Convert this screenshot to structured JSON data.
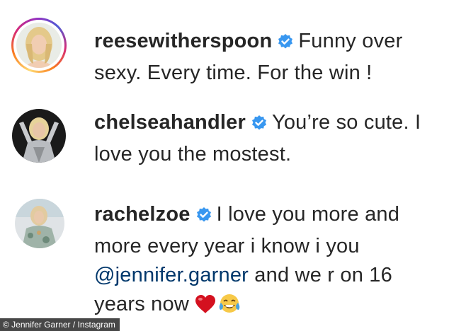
{
  "comments": [
    {
      "username": "reesewitherspoon",
      "text_line1": "Funny over",
      "text_rest": "sexy. Every time. For the win !"
    },
    {
      "username": "chelseahandler",
      "text_line1": "You’re so cute. I",
      "text_rest": "love you the mostest."
    },
    {
      "username": "rachelzoe",
      "text_line1": "I love you more and",
      "text_line2": "more every year i know i you",
      "mention": "@jennifer.garner",
      "text_after_mention": " and we r on 16",
      "text_line4": "years now"
    }
  ],
  "icons": {
    "verified": "verified-badge-icon",
    "heart": "red-heart-emoji",
    "laugh": "tears-of-joy-emoji"
  },
  "colors": {
    "verified": "#3897f0",
    "mention": "#00376b",
    "heart": "#d4111f"
  },
  "credit": "© Jennifer Garner / Instagram"
}
